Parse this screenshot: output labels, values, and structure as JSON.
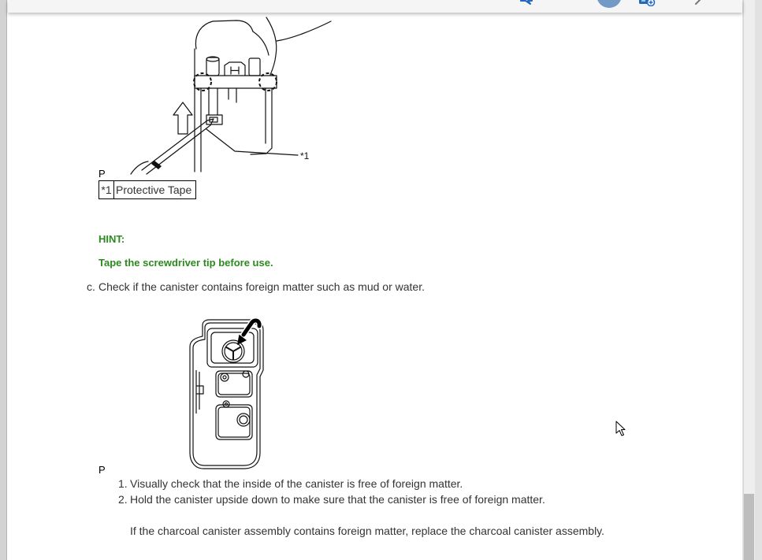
{
  "toolbar": {
    "icons": {
      "chat": "chat-bubble-icon",
      "profile": "user-avatar",
      "calendar": "calendar-add-icon",
      "back": "back-arrow-icon"
    }
  },
  "document": {
    "figure_1": {
      "callout": "*1",
      "label": "P"
    },
    "legend": {
      "key": "*1",
      "description": "Protective Tape"
    },
    "hint": {
      "heading": "HINT:",
      "text": "Tape the screwdriver tip before use."
    },
    "step_c": {
      "marker": "c.",
      "text": "Check if the canister contains foreign matter such as mud or water."
    },
    "figure_2": {
      "label": "P"
    },
    "checks": [
      {
        "marker": "1.",
        "text": "Visually check that the inside of the canister is free of foreign matter."
      },
      {
        "marker": "2.",
        "text": "Hold the canister upside down to make sure that the canister is free of foreign matter."
      }
    ],
    "note": "If the charcoal canister assembly contains foreign matter, replace the charcoal canister assembly."
  },
  "colors": {
    "text": "#333333",
    "hint": "#2b8a1e",
    "accent": "#2468c0",
    "avatar": "#7399c6"
  }
}
